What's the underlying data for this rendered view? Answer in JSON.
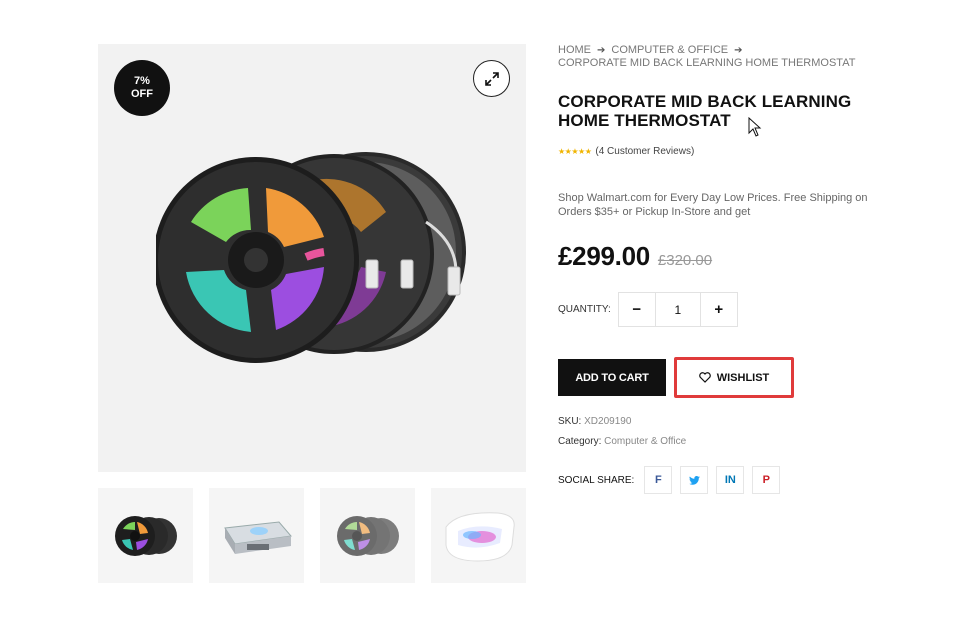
{
  "badge": {
    "line1": "7%",
    "line2": "OFF"
  },
  "breadcrumb": {
    "items": [
      "HOME",
      "COMPUTER & OFFICE",
      "CORPORATE MID BACK LEARNING HOME THERMOSTAT"
    ]
  },
  "product": {
    "title": "CORPORATE MID BACK LEARNING HOME THERMOSTAT",
    "stars": "★★★★★",
    "reviews": "(4 Customer Reviews)",
    "description": "Shop Walmart.com for Every Day Low Prices. Free Shipping on Orders $35+ or Pickup In-Store and get",
    "price": "£299.00",
    "old_price": "£320.00"
  },
  "quantity": {
    "label": "QUANTITY:",
    "minus": "−",
    "value": "1",
    "plus": "+"
  },
  "actions": {
    "add_to_cart": "ADD TO CART",
    "wishlist": "WISHLIST"
  },
  "meta": {
    "sku_label": "SKU:",
    "sku_value": "XD209190",
    "category_label": "Category:",
    "category_value": "Computer & Office"
  },
  "share": {
    "label": "SOCIAL SHARE:",
    "facebook": "f",
    "twitter": "t",
    "linkedin": "in",
    "pinterest": "p"
  },
  "colors": {
    "accent": "#111111",
    "highlight": "#e03b3b",
    "star": "#f0b400"
  },
  "icons": {
    "zoom": "expand-icon",
    "wishlist": "heart-icon",
    "breadcrumb_separator": "arrow-right-icon"
  }
}
